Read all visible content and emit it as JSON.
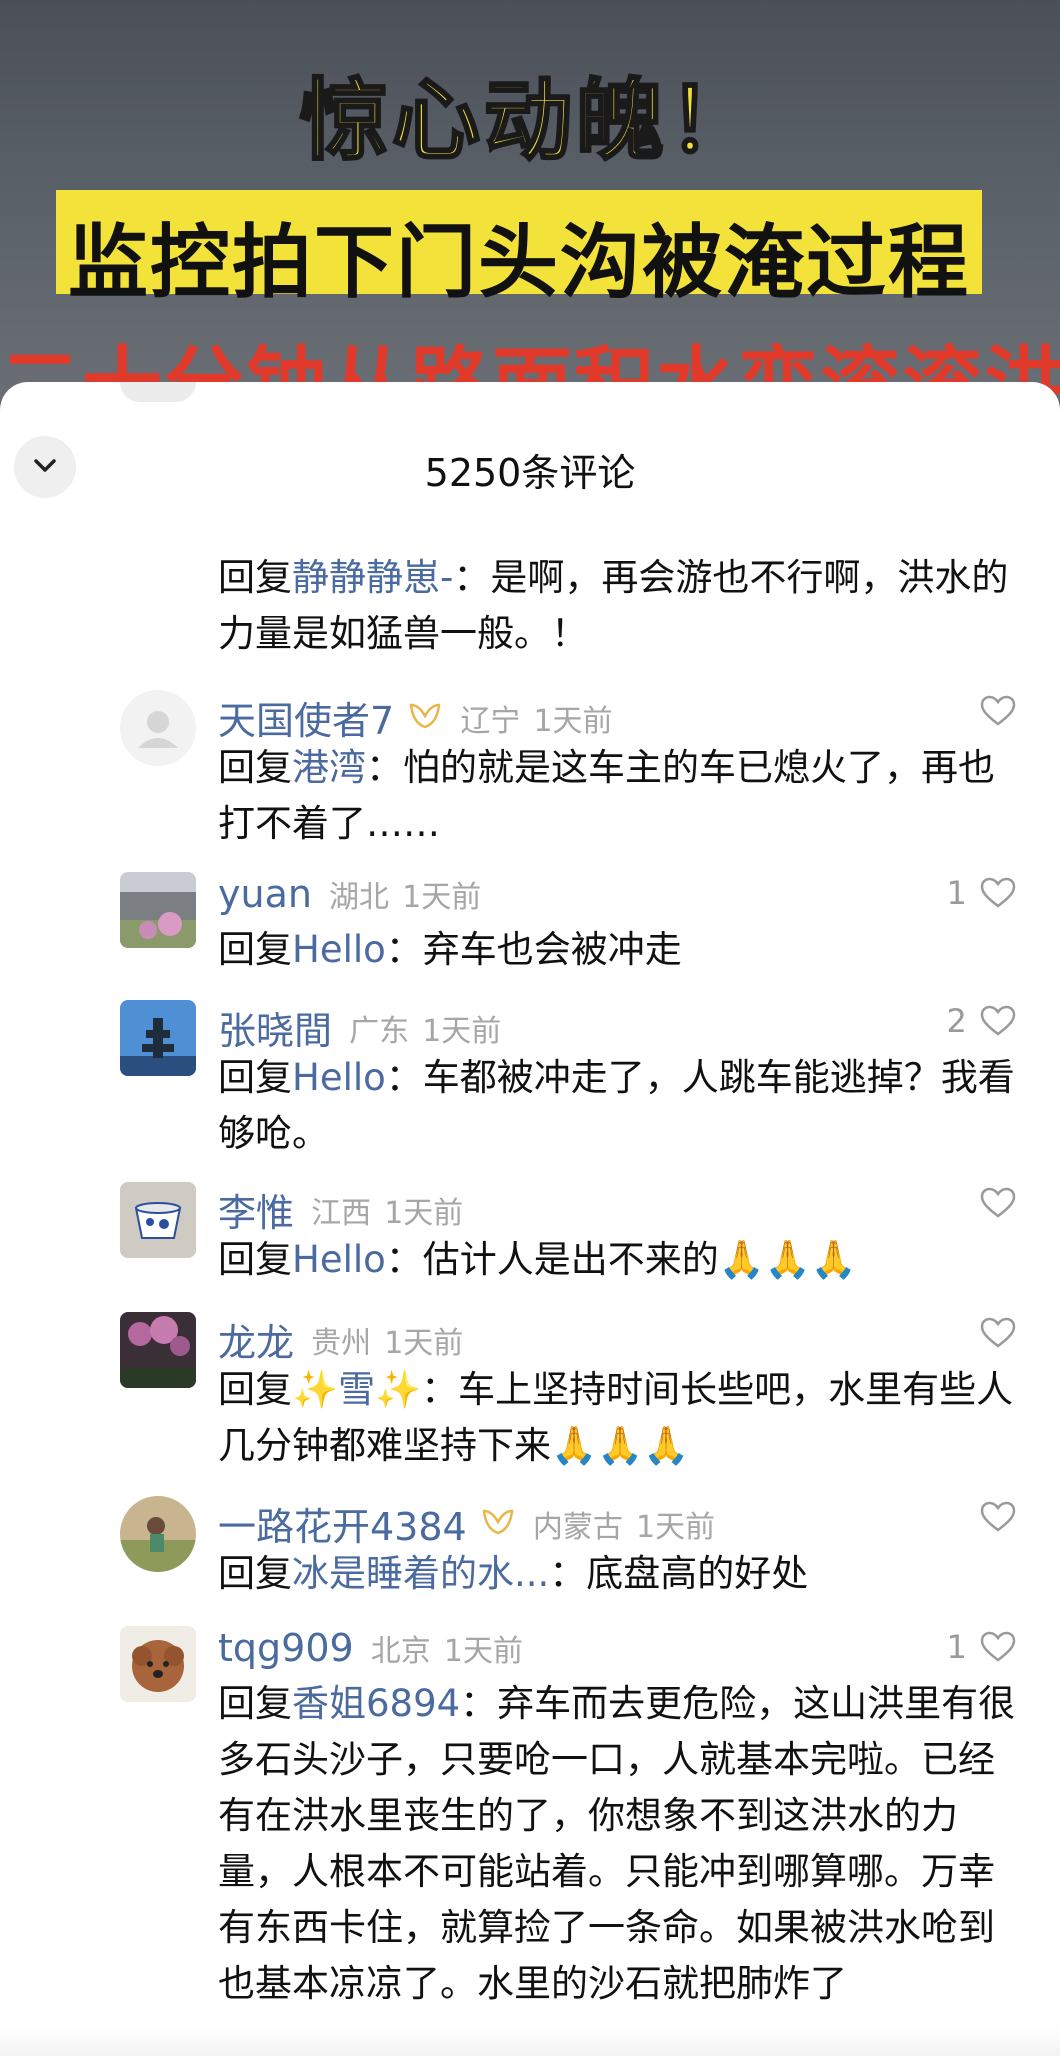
{
  "video": {
    "line1": "惊心动魄！",
    "line2": "监控拍下门头沟被淹过程",
    "line3": "二十分钟从路面积水变滚滚洪流"
  },
  "sheet": {
    "title": "5250条评论",
    "collapse_icon": "chevron-down-icon"
  },
  "colors": {
    "username": "#4a6aa0",
    "meta_gray": "#a6a6a6",
    "banner_yellow": "#f2e23a",
    "banner_red": "#e23a2a"
  },
  "comments": [
    {
      "reply_prefix": "回复",
      "reply_target": "静静静崽-",
      "text": "：是啊，再会游也不行啊，洪水的力量是如猛兽一般。！"
    },
    {
      "username": "天国使者7",
      "has_badge": true,
      "region": "辽宁",
      "time": "1天前",
      "likes": "",
      "reply_prefix": "回复",
      "reply_target": "港湾",
      "text": "：怕的就是这车主的车已熄火了，再也打不着了……"
    },
    {
      "username": "yuan",
      "region": "湖北",
      "time": "1天前",
      "likes": "1",
      "reply_prefix": "回复",
      "reply_target": "Hello",
      "text": "：弃车也会被冲走"
    },
    {
      "username": "张晓間",
      "region": "广东",
      "time": "1天前",
      "likes": "2",
      "reply_prefix": "回复",
      "reply_target": "Hello",
      "text": "：车都被冲走了，人跳车能逃掉？我看够呛。"
    },
    {
      "username": "李惟",
      "region": "江西",
      "time": "1天前",
      "likes": "",
      "reply_prefix": "回复",
      "reply_target": "Hello",
      "text": "：估计人是出不来的🙏🙏🙏"
    },
    {
      "username": "龙龙",
      "region": "贵州",
      "time": "1天前",
      "likes": "",
      "reply_prefix": "回复",
      "reply_target": "✨雪✨",
      "text": "：车上坚持时间长些吧，水里有些人几分钟都难坚持下来🙏🙏🙏"
    },
    {
      "username": "一路花开4384",
      "has_badge": true,
      "region": "内蒙古",
      "time": "1天前",
      "likes": "",
      "reply_prefix": "回复",
      "reply_target": "冰是睡着的水...",
      "text": "：底盘高的好处"
    },
    {
      "username": "tqg909",
      "region": "北京",
      "time": "1天前",
      "likes": "1",
      "reply_prefix": "回复",
      "reply_target": "香姐6894",
      "text": "：弃车而去更危险，这山洪里有很多石头沙子，只要呛一口，人就基本完啦。已经有在洪水里丧生的了，你想象不到这洪水的力量，人根本不可能站着。只能冲到哪算哪。万幸有东西卡住，就算捡了一条命。如果被洪水呛到也基本凉凉了。水里的沙石就把肺炸了"
    }
  ]
}
